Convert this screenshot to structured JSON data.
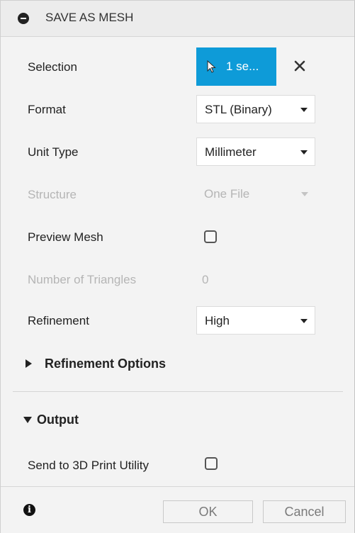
{
  "header": {
    "title": "SAVE AS MESH",
    "collapse_icon": "minus-circle-icon"
  },
  "fields": {
    "selection": {
      "label": "Selection",
      "button_text": "1 se...",
      "icon": "cursor-arrow-icon",
      "clear_icon": "close-icon",
      "accent": "#0e9bd8"
    },
    "format": {
      "label": "Format",
      "value": "STL (Binary)"
    },
    "unit_type": {
      "label": "Unit Type",
      "value": "Millimeter"
    },
    "structure": {
      "label": "Structure",
      "value": "One File",
      "disabled": true
    },
    "preview_mesh": {
      "label": "Preview Mesh",
      "checked": false
    },
    "number_of_triangles": {
      "label": "Number of Triangles",
      "value": "0",
      "disabled": true
    },
    "refinement": {
      "label": "Refinement",
      "value": "High"
    }
  },
  "sections": {
    "refinement_options": {
      "label": "Refinement Options",
      "expanded": false
    },
    "output": {
      "label": "Output",
      "expanded": true
    }
  },
  "output": {
    "send_to_3d_print": {
      "label": "Send to 3D Print Utility",
      "checked": false
    }
  },
  "footer": {
    "info_icon": "info-icon",
    "ok_label": "OK",
    "cancel_label": "Cancel"
  }
}
